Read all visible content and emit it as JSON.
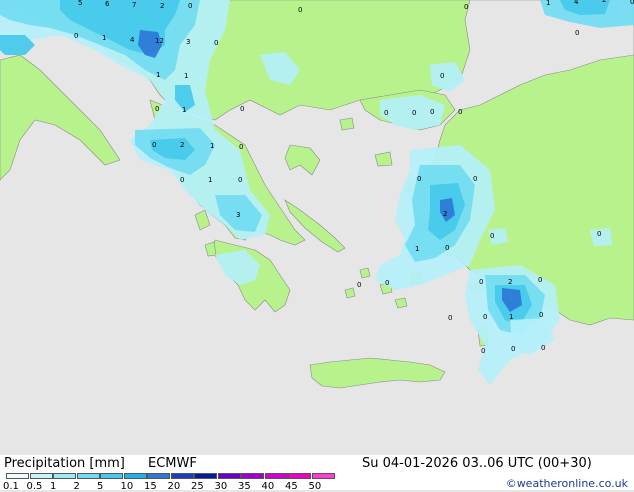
{
  "footer": {
    "title": "Precipitation [mm]",
    "model": "ECMWF",
    "datetime": "Su 04-01-2026 03..06 UTC (00+30)",
    "credit": "©weatheronline.co.uk"
  },
  "colorbar": {
    "ticks": [
      "0.1",
      "0.5",
      "1",
      "2",
      "5",
      "10",
      "15",
      "20",
      "25",
      "30",
      "35",
      "40",
      "45",
      "50"
    ],
    "colors": [
      "#f0fcff",
      "#c6f4fb",
      "#9eeaf7",
      "#72dcf2",
      "#45c9ec",
      "#1fb3e2",
      "#2e78d6",
      "#1d3fbf",
      "#0a1a96",
      "#6b00c8",
      "#a000d8",
      "#d200d2",
      "#f000c0",
      "#ff3cd8"
    ]
  },
  "map_colors": {
    "sea": "#e6e6e6",
    "land": "#b8f28c",
    "rain_light": "#b4f0fa",
    "rain_mid": "#72dcf2",
    "rain_heavy": "#45c9ec",
    "rain_peak": "#2e78d6"
  },
  "values": [
    {
      "text": "5"
    },
    {
      "text": "6"
    },
    {
      "text": "7"
    },
    {
      "text": "2"
    },
    {
      "text": "0"
    },
    {
      "text": "0"
    },
    {
      "text": "0"
    },
    {
      "text": "1"
    },
    {
      "text": "4"
    },
    {
      "text": "2"
    },
    {
      "text": "0"
    },
    {
      "text": "0"
    },
    {
      "text": "1"
    },
    {
      "text": "4"
    },
    {
      "text": "12"
    },
    {
      "text": "3"
    },
    {
      "text": "0"
    },
    {
      "text": "1"
    },
    {
      "text": "1"
    },
    {
      "text": "0"
    },
    {
      "text": "1"
    },
    {
      "text": "0"
    },
    {
      "text": "0"
    },
    {
      "text": "0"
    },
    {
      "text": "0"
    },
    {
      "text": "0"
    },
    {
      "text": "0"
    },
    {
      "text": "2"
    },
    {
      "text": "1"
    },
    {
      "text": "0"
    },
    {
      "text": "0"
    },
    {
      "text": "1"
    },
    {
      "text": "0"
    },
    {
      "text": "3"
    },
    {
      "text": "0"
    },
    {
      "text": "0"
    },
    {
      "text": "2"
    },
    {
      "text": "1"
    },
    {
      "text": "0"
    },
    {
      "text": "0"
    },
    {
      "text": "0"
    },
    {
      "text": "0"
    },
    {
      "text": "0"
    },
    {
      "text": "0"
    },
    {
      "text": "2"
    },
    {
      "text": "0"
    },
    {
      "text": "0"
    },
    {
      "text": "0"
    },
    {
      "text": "1"
    },
    {
      "text": "0"
    },
    {
      "text": "0"
    },
    {
      "text": "0"
    },
    {
      "text": "0"
    },
    {
      "text": "0"
    },
    {
      "text": "0"
    }
  ]
}
